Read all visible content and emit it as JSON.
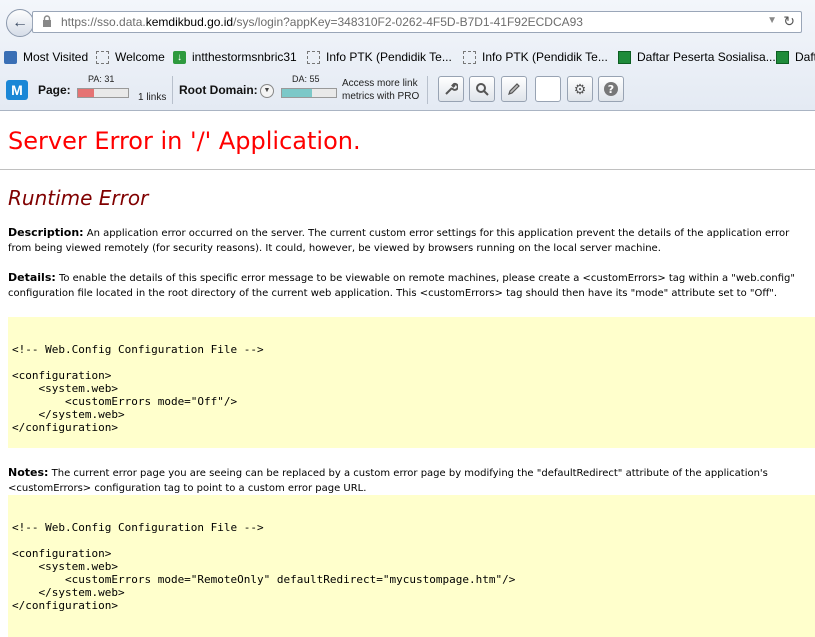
{
  "browser": {
    "url_prefix": "https://sso.data.",
    "url_domain": "kemdikbud.go.id",
    "url_suffix": "/sys/login?appKey=348310F2-0262-4F5D-B7D1-41F92ECDCA93",
    "icons": {
      "back": "back-arrow-icon",
      "lock": "lock-icon",
      "reload": "reload-icon",
      "dropdown": "chevron-down-icon"
    }
  },
  "bookmarks": [
    {
      "label": "Most Visited",
      "icon": "most-visited-icon"
    },
    {
      "label": "Welcome",
      "icon": "blank-page-icon"
    },
    {
      "label": "intthestormsnbric31",
      "icon": "download-icon"
    },
    {
      "label": "Info PTK (Pendidik Te...",
      "icon": "blank-page-icon"
    },
    {
      "label": "Info PTK (Pendidik Te...",
      "icon": "blank-page-icon"
    },
    {
      "label": "Daftar Peserta Sosialisa...",
      "icon": "spreadsheet-icon"
    },
    {
      "label": "Daft",
      "icon": "spreadsheet-icon"
    }
  ],
  "mozbar": {
    "page_label": "Page:",
    "pa_label": "PA: 31",
    "pa_value": 31,
    "links_label": "1 links",
    "root_domain_label": "Root Domain:",
    "da_label": "DA: 55",
    "da_value": 55,
    "pro_text_line1": "Access more link",
    "pro_text_line2": "metrics with PRO",
    "pa_color": "#e57373",
    "da_color": "#7cc8c8",
    "tools": [
      "wrench-icon",
      "search-icon",
      "pencil-icon",
      "blank-button",
      "gear-icon",
      "help-icon"
    ]
  },
  "page": {
    "title": "Server Error in '/' Application.",
    "subtitle": "Runtime Error",
    "description_label": "Description:",
    "description_text": " An application error occurred on the server. The current custom error settings for this application prevent the details of the application error from being viewed remotely (for security reasons). It could, however, be viewed by browsers running on the local server machine.",
    "details_label": "Details:",
    "details_text": " To enable the details of this specific error message to be viewable on remote machines, please create a <customErrors> tag within a \"web.config\" configuration file located in the root directory of the current web application. This <customErrors> tag should then have its \"mode\" attribute set to \"Off\".",
    "code1": "<!-- Web.Config Configuration File -->\n\n<configuration>\n    <system.web>\n        <customErrors mode=\"Off\"/>\n    </system.web>\n</configuration>",
    "notes_label": "Notes:",
    "notes_text": " The current error page you are seeing can be replaced by a custom error page by modifying the \"defaultRedirect\" attribute of the application's <customErrors> configuration tag to point to a custom error page URL.",
    "code2": "<!-- Web.Config Configuration File -->\n\n<configuration>\n    <system.web>\n        <customErrors mode=\"RemoteOnly\" defaultRedirect=\"mycustompage.htm\"/>\n    </system.web>\n</configuration>",
    "title_color": "#ff0000",
    "subtitle_color": "#800000",
    "code_bg": "#ffffcc"
  }
}
